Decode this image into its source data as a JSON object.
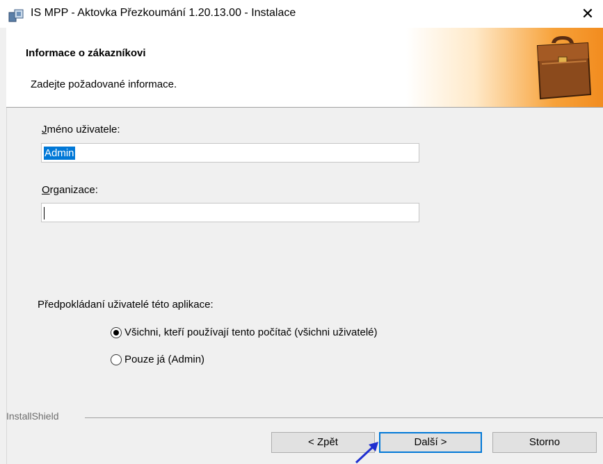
{
  "window": {
    "title": "IS MPP - Aktovka Přezkoumání 1.20.13.00 - Instalace",
    "close_glyph": "✕"
  },
  "header": {
    "title": "Informace o zákazníkovi",
    "subtitle": "Zadejte požadované informace."
  },
  "form": {
    "username_label_accel": "J",
    "username_label_rest": "méno uživatele:",
    "username_value": "Admin",
    "org_label_accel": "O",
    "org_label_rest": "rganizace:",
    "org_value": ""
  },
  "users": {
    "label": "Předpokládaní uživatelé této aplikace:",
    "options": [
      {
        "label": "Všichni, kteří používají tento počítač (všichni uživatelé)",
        "selected": true
      },
      {
        "label": "Pouze já (Admin)",
        "selected": false
      }
    ]
  },
  "footer": {
    "brand": "InstallShield",
    "back_label": "< Zpět",
    "next_label": "Další >",
    "cancel_label": "Storno"
  },
  "colors": {
    "accent": "#0078d7",
    "header_gradient_end": "#f28c1f"
  }
}
